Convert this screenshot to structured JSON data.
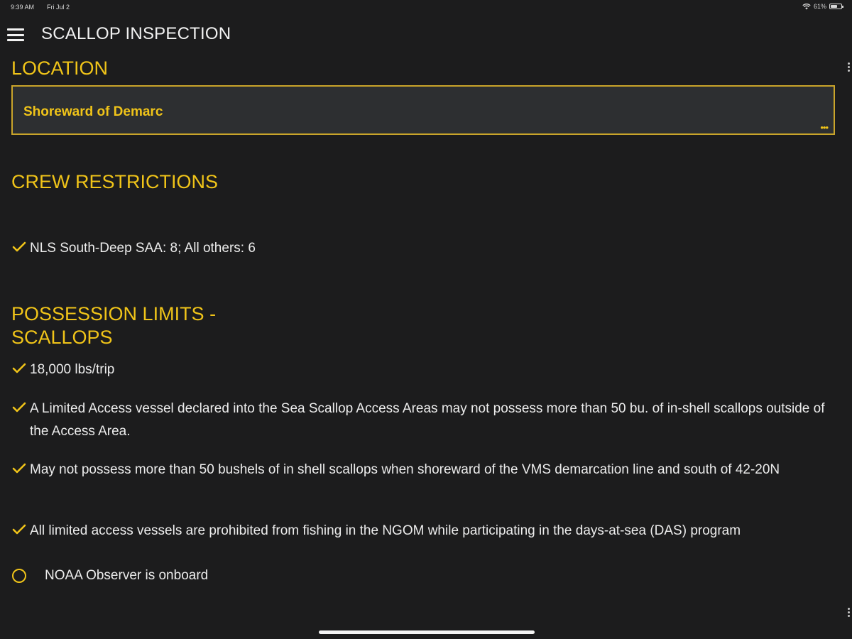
{
  "status_bar": {
    "time": "9:39 AM",
    "date": "Fri Jul 2",
    "battery": "61%",
    "battery_level": 0.61,
    "icons": [
      "wifi-icon",
      "battery-icon"
    ]
  },
  "header": {
    "title": "SCALLOP INSPECTION",
    "menu_icon": "hamburger-menu-icon"
  },
  "location": {
    "heading": "LOCATION",
    "value": "Shoreward of Demarc",
    "more_icon": "ellipsis-icon",
    "more_glyph": "•••"
  },
  "crew": {
    "heading": "CREW RESTRICTIONS",
    "items": [
      "NLS South-Deep SAA: 8; All others: 6"
    ]
  },
  "possession": {
    "heading": "POSSESSION LIMITS - SCALLOPS",
    "items": [
      "18,000 lbs/trip",
      "A Limited Access vessel declared into the Sea Scallop Access Areas may not possess more than 50 bu. of in-shell scallops outside of the Access Area.",
      "May not possess more than 50 bushels of in shell scallops when shoreward of the VMS demarcation line and south of 42-20N",
      "All limited access vessels are prohibited from fishing in the NGOM while participating in the days-at-sea (DAS) program"
    ]
  },
  "observer": {
    "label": "NOAA Observer is onboard",
    "selected": false
  },
  "colors": {
    "accent": "#f0c419",
    "background": "#1c1c1d",
    "text": "#ececec",
    "field_background": "#2d2f31",
    "field_border": "#c9a42a"
  }
}
